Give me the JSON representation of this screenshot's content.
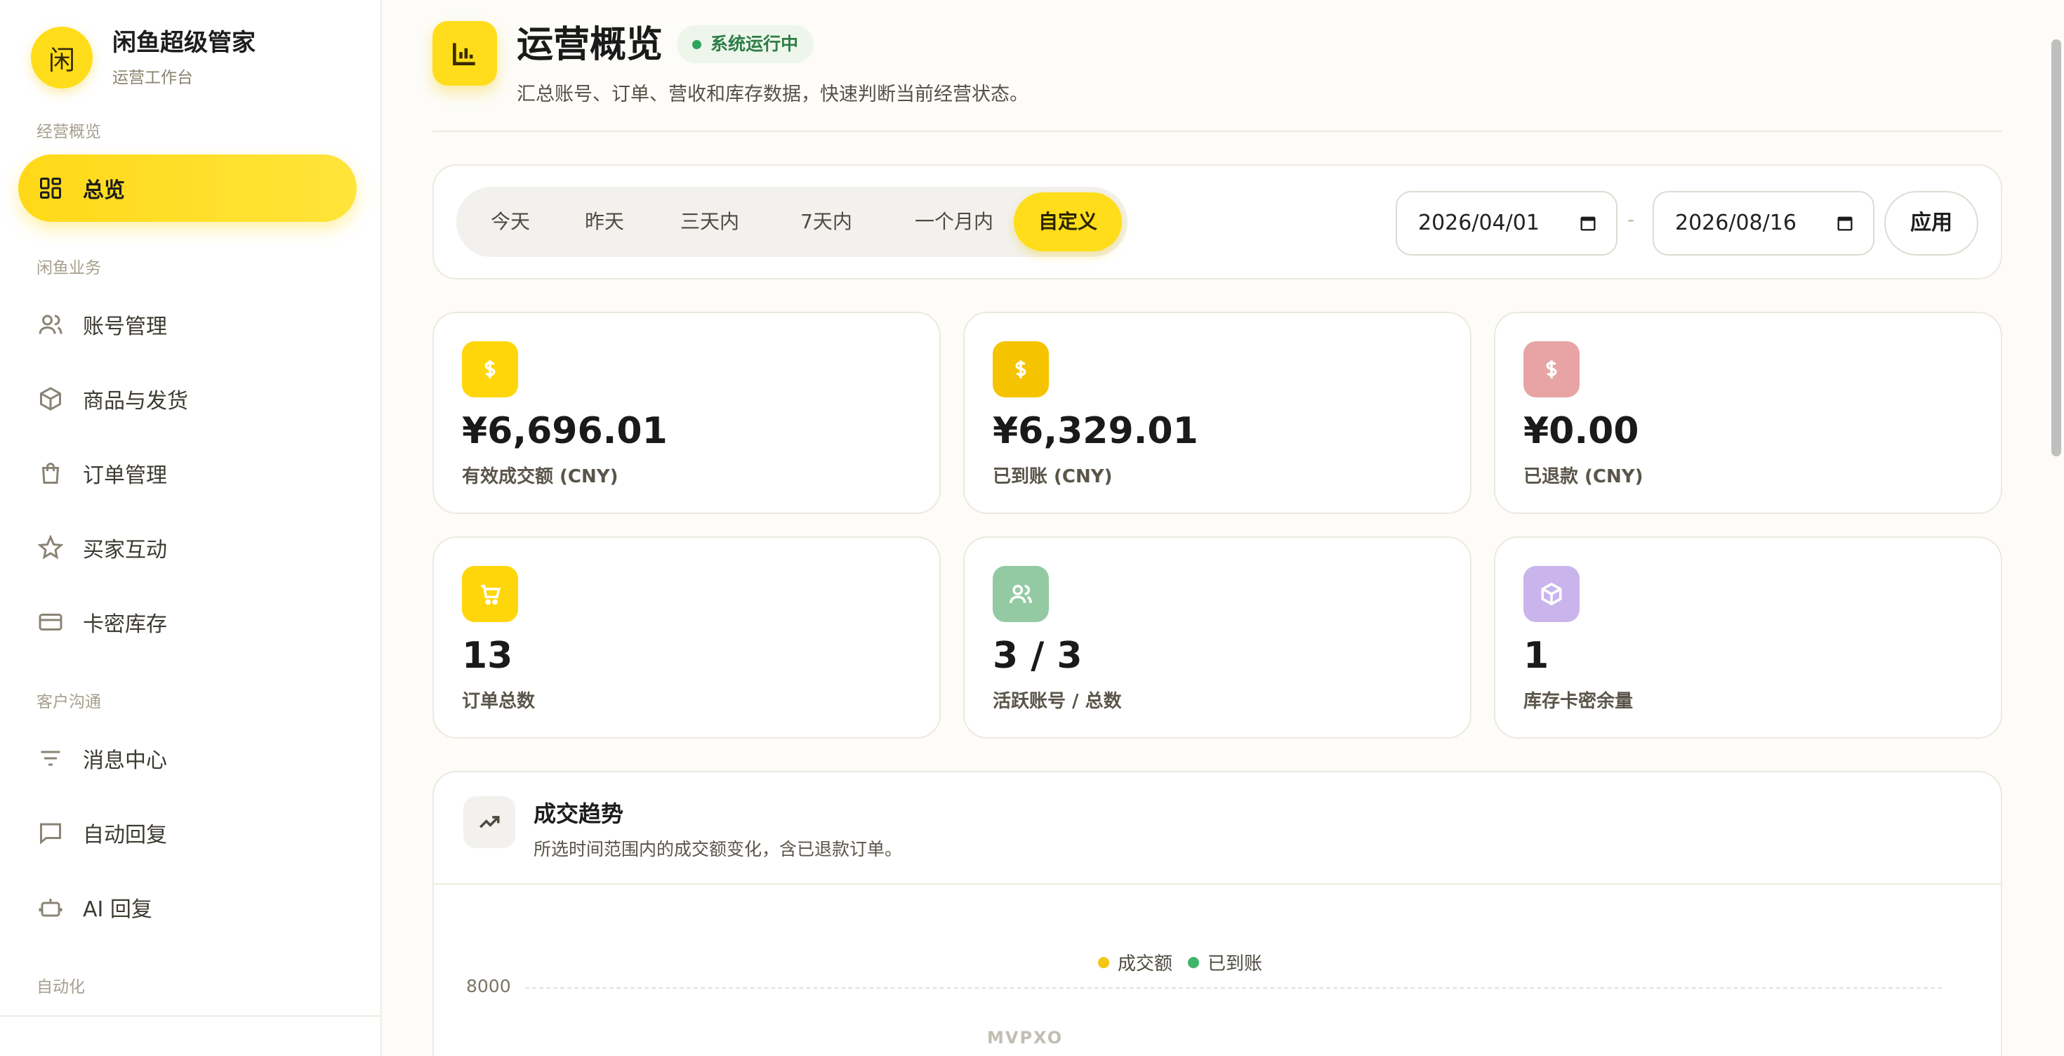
{
  "brand": {
    "logo_char": "闲",
    "title": "闲鱼超级管家",
    "subtitle": "运营工作台"
  },
  "sidebar": {
    "sections": [
      {
        "label": "经营概览"
      },
      {
        "label": "闲鱼业务"
      },
      {
        "label": "客户沟通"
      },
      {
        "label": "自动化"
      }
    ],
    "items": [
      {
        "label": "总览",
        "icon": "dashboard-icon",
        "active": true
      },
      {
        "label": "账号管理",
        "icon": "users-icon"
      },
      {
        "label": "商品与发货",
        "icon": "package-icon"
      },
      {
        "label": "订单管理",
        "icon": "shopping-bag-icon"
      },
      {
        "label": "买家互动",
        "icon": "star-icon"
      },
      {
        "label": "卡密库存",
        "icon": "credit-card-icon"
      },
      {
        "label": "消息中心",
        "icon": "filter-lines-icon"
      },
      {
        "label": "自动回复",
        "icon": "message-square-icon"
      },
      {
        "label": "AI 回复",
        "icon": "bot-icon"
      }
    ]
  },
  "header": {
    "icon": "bar-chart-icon",
    "title": "运营概览",
    "status": "系统运行中",
    "description": "汇总账号、订单、营收和库存数据，快速判断当前经营状态。"
  },
  "filter": {
    "ranges": [
      "今天",
      "昨天",
      "三天内",
      "7天内",
      "一个月内",
      "自定义"
    ],
    "active_range": "自定义",
    "start_date": "2026/04/01",
    "end_date": "2026/08/16",
    "separator": "-",
    "apply_label": "应用"
  },
  "stats": [
    {
      "value": "¥6,696.01",
      "label": "有效成交额 (CNY)",
      "icon": "dollar-icon",
      "color": "#ffd60a"
    },
    {
      "value": "¥6,329.01",
      "label": "已到账 (CNY)",
      "icon": "dollar-icon",
      "color": "#f5c300"
    },
    {
      "value": "¥0.00",
      "label": "已退款 (CNY)",
      "icon": "dollar-icon",
      "color": "#e8a4a4"
    },
    {
      "value": "13",
      "label": "订单总数",
      "icon": "cart-icon",
      "color": "#ffd60a"
    },
    {
      "value": "3 / 3",
      "label": "活跃账号 / 总数",
      "icon": "users-icon",
      "color": "#93c9a3"
    },
    {
      "value": "1",
      "label": "库存卡密余量",
      "icon": "box-icon",
      "color": "#c9b5ec"
    }
  ],
  "trend": {
    "icon": "trending-up-icon",
    "title": "成交趋势",
    "description": "所选时间范围内的成交额变化，含已退款订单。",
    "legend": [
      {
        "name": "成交额",
        "color": "#f5c518"
      },
      {
        "name": "已到账",
        "color": "#3fb56b"
      }
    ],
    "y_tick": "8000",
    "watermark": "MVPXO"
  }
}
